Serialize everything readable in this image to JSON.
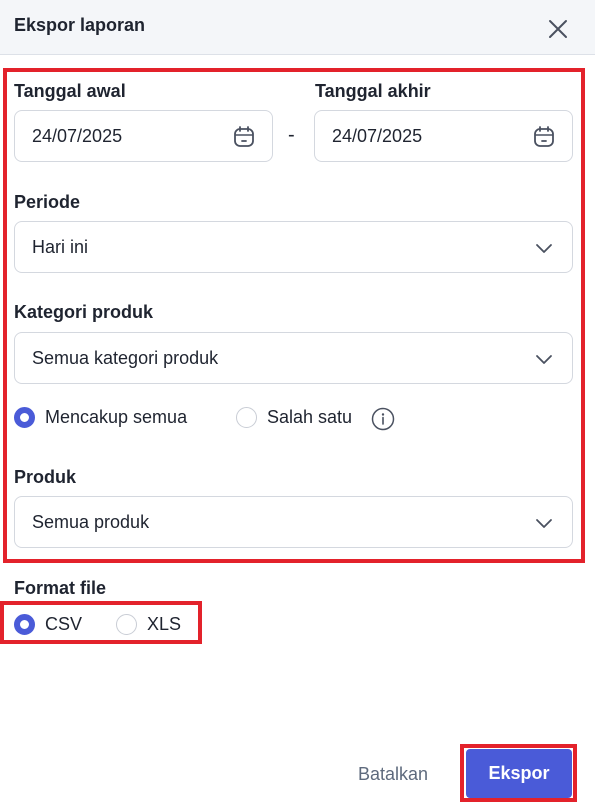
{
  "header": {
    "title": "Ekspor laporan",
    "close_icon": "close-icon"
  },
  "date_range": {
    "start_label": "Tanggal awal",
    "start_value": "24/07/2025",
    "separator": "-",
    "end_label": "Tanggal akhir",
    "end_value": "24/07/2025",
    "icon": "calendar-icon"
  },
  "period": {
    "label": "Periode",
    "selected": "Hari ini"
  },
  "category": {
    "label": "Kategori produk",
    "selected": "Semua kategori produk",
    "match_options": [
      {
        "label": "Mencakup semua",
        "selected": true
      },
      {
        "label": "Salah satu",
        "selected": false
      }
    ]
  },
  "product": {
    "label": "Produk",
    "selected": "Semua produk"
  },
  "file_format": {
    "label": "Format file",
    "options": [
      {
        "label": "CSV",
        "selected": true
      },
      {
        "label": "XLS",
        "selected": false
      }
    ]
  },
  "footer": {
    "cancel_label": "Batalkan",
    "export_label": "Ekspor"
  },
  "colors": {
    "accent": "#4a5bd8",
    "highlight": "#e3222b",
    "header_bg": "#f4f6f9"
  }
}
